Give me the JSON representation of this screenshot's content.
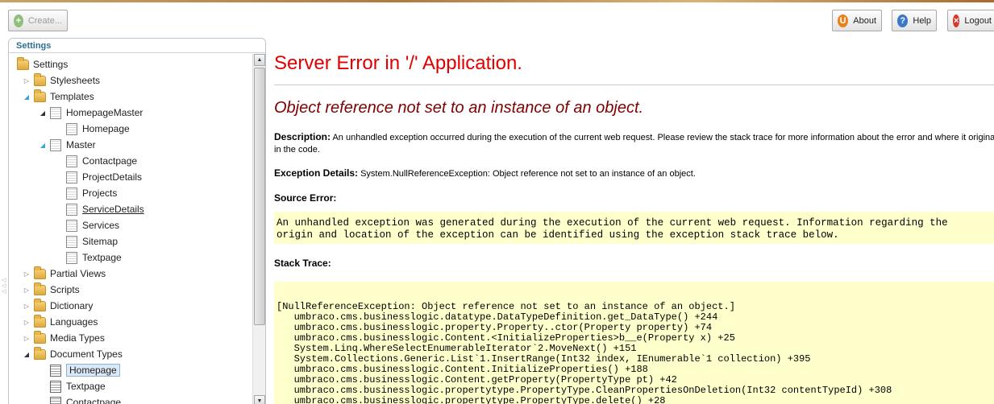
{
  "toolbar": {
    "create_label": "Create...",
    "about_label": "About",
    "help_label": "Help",
    "logout_label": "Logout"
  },
  "tree": {
    "header": "Settings",
    "root": "Settings",
    "items": [
      {
        "label": "Stylesheets"
      },
      {
        "label": "Templates"
      },
      {
        "label": "HomepageMaster"
      },
      {
        "label": "Homepage"
      },
      {
        "label": "Master"
      },
      {
        "label": "Contactpage"
      },
      {
        "label": "ProjectDetails"
      },
      {
        "label": "Projects"
      },
      {
        "label": "ServiceDetails"
      },
      {
        "label": "Services"
      },
      {
        "label": "Sitemap"
      },
      {
        "label": "Textpage"
      },
      {
        "label": "Partial Views"
      },
      {
        "label": "Scripts"
      },
      {
        "label": "Dictionary"
      },
      {
        "label": "Languages"
      },
      {
        "label": "Media Types"
      },
      {
        "label": "Document Types"
      },
      {
        "label": "Homepage"
      },
      {
        "label": "Textpage"
      },
      {
        "label": "Contactpage"
      }
    ]
  },
  "error": {
    "title": "Server Error in '/' Application.",
    "message": "Object reference not set to an instance of an object.",
    "description_label": "Description:",
    "description_text": "An unhandled exception occurred during the execution of the current web request. Please review the stack trace for more information about the error and where it originated",
    "description_text2": "in the code.",
    "exception_label": "Exception Details:",
    "exception_text": "System.NullReferenceException: Object reference not set to an instance of an object.",
    "source_label": "Source Error:",
    "source_line1": "An unhandled exception was generated during the execution of the current web request. Information regarding the",
    "source_line2": "origin and location of the exception can be identified using the exception stack trace below.",
    "stack_label": "Stack Trace:",
    "stack_lines": [
      "[NullReferenceException: Object reference not set to an instance of an object.]",
      "   umbraco.cms.businesslogic.datatype.DataTypeDefinition.get_DataType() +244",
      "   umbraco.cms.businesslogic.property.Property..ctor(Property property) +74",
      "   umbraco.cms.businesslogic.Content.<InitializeProperties>b__e(Property x) +25",
      "   System.Linq.WhereSelectEnumerableIterator`2.MoveNext() +151",
      "   System.Collections.Generic.List`1.InsertRange(Int32 index, IEnumerable`1 collection) +395",
      "   umbraco.cms.businesslogic.Content.InitializeProperties() +188",
      "   umbraco.cms.businesslogic.Content.getProperty(PropertyType pt) +42",
      "   umbraco.cms.businesslogic.propertytype.PropertyType.CleanPropertiesOnDeletion(Int32 contentTypeId) +308",
      "   umbraco.cms.businesslogic.propertytype.PropertyType.delete() +28"
    ]
  }
}
